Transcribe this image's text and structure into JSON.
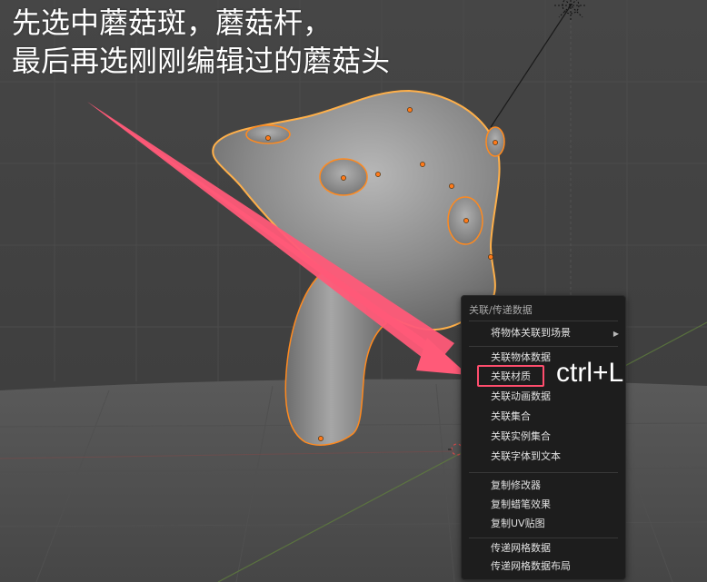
{
  "caption": {
    "line1": "先选中蘑菇斑，蘑菇杆，",
    "line2": "最后再选刚刚编辑过的蘑菇头"
  },
  "shortcut": "ctrl+L",
  "menu": {
    "title": "关联/传递数据",
    "items": [
      {
        "label": "将物体关联到场景",
        "has_submenu": true
      },
      {
        "label": "关联物体数据"
      },
      {
        "label": "关联材质",
        "highlighted": true
      },
      {
        "label": "关联动画数据"
      },
      {
        "label": "关联集合"
      },
      {
        "label": "关联实例集合"
      },
      {
        "label": "关联字体到文本"
      },
      {
        "label": "复制修改器"
      },
      {
        "label": "复制蜡笔效果"
      },
      {
        "label": "复制UV贴图"
      },
      {
        "label": "传递网格数据"
      },
      {
        "label": "传递网格数据布局"
      }
    ]
  },
  "colors": {
    "viewport_bg": "#3c3c3c",
    "menu_bg": "#1d1d1d",
    "selection_outline": "#ff8a1f",
    "active_outline": "#ffb04a",
    "annotation_red": "#ff4d6d"
  },
  "icons": {
    "submenu": "chevron-right-icon",
    "light": "light-object-icon",
    "arrow": "annotation-arrow-icon"
  }
}
